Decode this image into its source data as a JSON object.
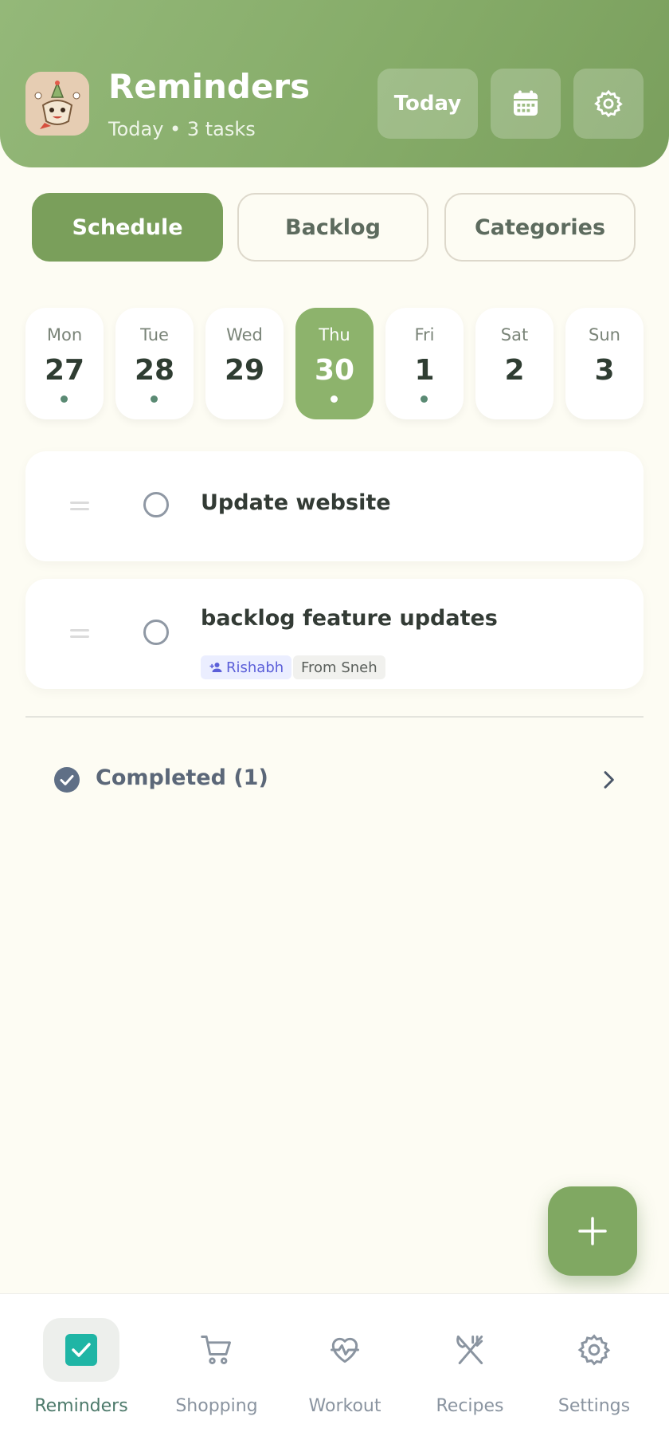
{
  "header": {
    "title": "Reminders",
    "subtitle": "Today • 3 tasks",
    "today_button": "Today",
    "calendar_icon": "calendar-icon",
    "settings_icon": "gear-icon",
    "accent_color": "#86ac69"
  },
  "segments": {
    "items": [
      "Schedule",
      "Backlog",
      "Categories"
    ],
    "active": "Schedule"
  },
  "week": {
    "days": [
      {
        "name": "Mon",
        "num": "27",
        "has_tasks": true,
        "selected": false
      },
      {
        "name": "Tue",
        "num": "28",
        "has_tasks": true,
        "selected": false
      },
      {
        "name": "Wed",
        "num": "29",
        "has_tasks": false,
        "selected": false
      },
      {
        "name": "Thu",
        "num": "30",
        "has_tasks": true,
        "selected": true
      },
      {
        "name": "Fri",
        "num": "1",
        "has_tasks": true,
        "selected": false
      },
      {
        "name": "Sat",
        "num": "2",
        "has_tasks": false,
        "selected": false
      },
      {
        "name": "Sun",
        "num": "3",
        "has_tasks": false,
        "selected": false
      }
    ]
  },
  "tasks": [
    {
      "title": "Update website"
    },
    {
      "title": "backlog feature updates",
      "assignee": "Rishabh",
      "from": "From Sneh"
    }
  ],
  "completed": {
    "label": "Completed (1)"
  },
  "bottom_nav": {
    "items": [
      {
        "label": "Reminders",
        "icon": "check-square-icon",
        "active": true
      },
      {
        "label": "Shopping",
        "icon": "cart-icon",
        "active": false
      },
      {
        "label": "Workout",
        "icon": "heart-pulse-icon",
        "active": false
      },
      {
        "label": "Recipes",
        "icon": "utensils-icon",
        "active": false
      },
      {
        "label": "Settings",
        "icon": "gear-icon",
        "active": false
      }
    ]
  }
}
